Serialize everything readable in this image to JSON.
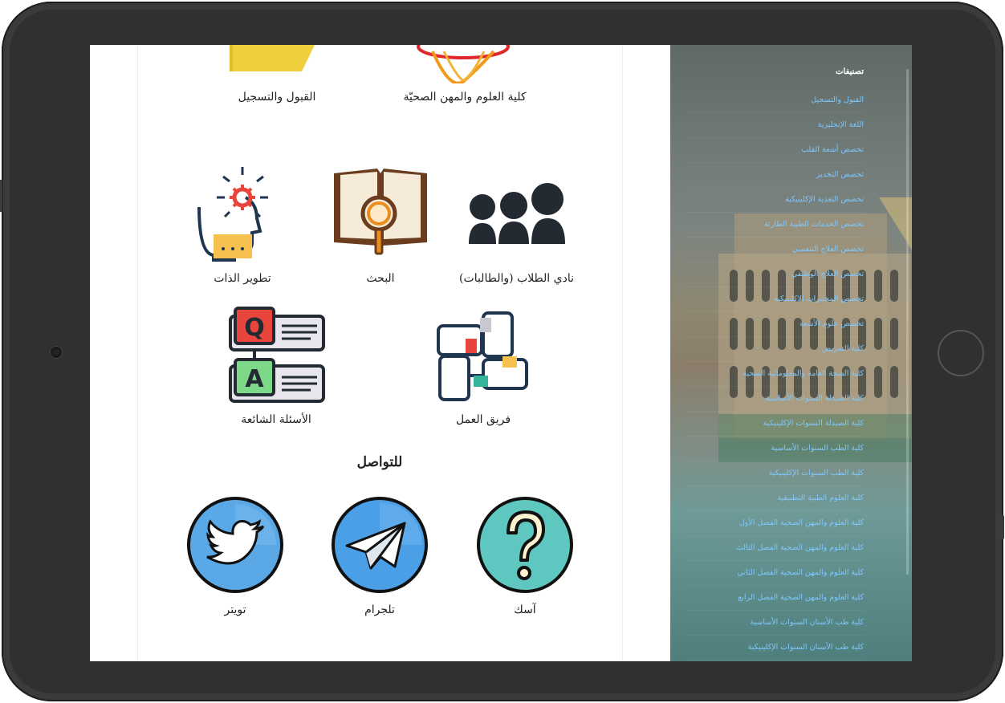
{
  "sections": {
    "top_labels": [
      "القبول والتسجيل",
      "كلية العلوم والمهن الصحيّة"
    ],
    "row1": [
      "تطوير الذات",
      "البحث",
      "نادي الطلاب (والطالبات)"
    ],
    "row2": [
      "الأسئلة الشائعة",
      "فريق العمل"
    ],
    "contact_heading": "للتواصل",
    "contact": [
      "تويتر",
      "تلجرام",
      "آسك"
    ]
  },
  "qa_icon": {
    "q": "Q",
    "a": "A"
  },
  "sidebar": {
    "title": "تصنيفات",
    "items": [
      "القبول والتسجيل",
      "اللغة الإنجليزية",
      "تخصص أشعة القلب",
      "تخصص التخدير",
      "تخصص التغذية الإكلينيكية",
      "تخصص الخدمات الطبية الطارئة",
      "تخصص العلاج التنفسي",
      "تخصص العلاج الوظيفي",
      "تخصص المختبرات الإكلينيكية",
      "تخصص علوم الأشعة",
      "كلية التمريض",
      "كلية الصحة العامة والمعلوماتية الصحية",
      "كلية الصيدلة السنوات الأساسية",
      "كلية الصيدلة السنوات الإكلينيكية",
      "كلية الطب السنوات الأساسية",
      "كلية الطب السنوات الإكلينيكية",
      "كلية العلوم الطبية التطبيقية",
      "كلية العلوم والمهن الصحية الفصل الأول",
      "كلية العلوم والمهن الصحية الفصل الثالث",
      "كلية العلوم والمهن الصحية الفصل الثاني",
      "كلية العلوم والمهن الصحية الفصل الرابع",
      "كلية طب الأسنان السنوات الأساسية",
      "كلية طب الأسنان السنوات الإكلينيكية"
    ]
  },
  "colors": {
    "frame": "#2f3031",
    "link": "#7fc8ff",
    "twitter": "#5aa9e6",
    "telegram": "#4a9fe6",
    "ask": "#5ec7bf"
  }
}
